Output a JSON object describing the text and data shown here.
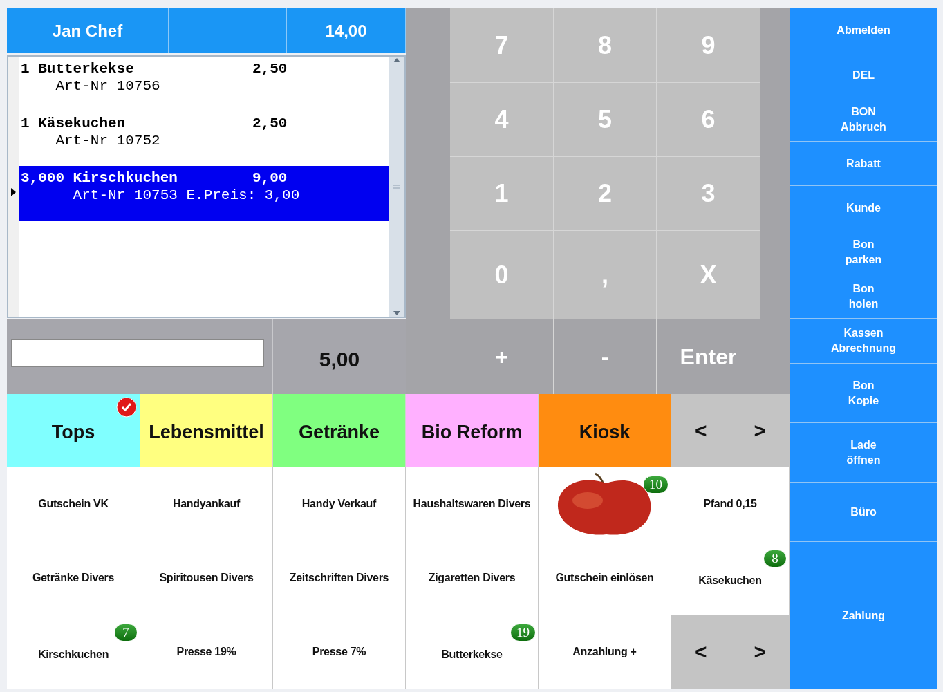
{
  "header": {
    "user": "Jan Chef",
    "total": "14,00"
  },
  "receipt": {
    "lines": [
      {
        "qty": "1",
        "name": "Butterkekse",
        "price": "2,50",
        "detail": "Art-Nr 10756",
        "selected": false
      },
      {
        "qty": "1",
        "name": "Käsekuchen",
        "price": "2,50",
        "detail": "Art-Nr 10752",
        "selected": false
      },
      {
        "qty": "3,000",
        "name": "Kirschkuchen",
        "price": "9,00",
        "detail": "Art-Nr 10753 E.Preis: 3,00",
        "selected": true
      }
    ]
  },
  "entry": {
    "amount": "5,00"
  },
  "keypad": [
    [
      "7",
      "8",
      "9"
    ],
    [
      "4",
      "5",
      "6"
    ],
    [
      "1",
      "2",
      "3"
    ],
    [
      "0",
      ",",
      "X"
    ],
    [
      "+",
      "-",
      "Enter"
    ]
  ],
  "categories": [
    {
      "label": "Tops",
      "color": "#80ffff",
      "selected": true
    },
    {
      "label": "Lebensmittel",
      "color": "#ffff80",
      "selected": false
    },
    {
      "label": "Getränke",
      "color": "#80ff80",
      "selected": false
    },
    {
      "label": "Bio Reform",
      "color": "#ffb0ff",
      "selected": false
    },
    {
      "label": "Kiosk",
      "color": "#ff8c10",
      "selected": false
    }
  ],
  "category_nav": {
    "prev": "<",
    "next": ">"
  },
  "products": [
    {
      "kind": "text",
      "label": "Gutschein VK"
    },
    {
      "kind": "text",
      "label": "Handyankauf"
    },
    {
      "kind": "text",
      "label": "Handy Verkauf"
    },
    {
      "kind": "text",
      "label": "Haushaltswaren Divers"
    },
    {
      "kind": "image",
      "badge": "10"
    },
    {
      "kind": "text",
      "label": "Pfand 0,15"
    },
    {
      "kind": "text",
      "label": "Getränke Divers"
    },
    {
      "kind": "text",
      "label": "Spiritousen Divers"
    },
    {
      "kind": "text",
      "label": "Zeitschriften Divers"
    },
    {
      "kind": "text",
      "label": "Zigaretten Divers"
    },
    {
      "kind": "text",
      "label": "Gutschein einlösen"
    },
    {
      "kind": "text",
      "label": "Käsekuchen",
      "badge": "8"
    },
    {
      "kind": "text",
      "label": "Kirschkuchen",
      "badge": "7"
    },
    {
      "kind": "text",
      "label": "Presse 19%"
    },
    {
      "kind": "text",
      "label": "Presse 7%"
    },
    {
      "kind": "text",
      "label": "Butterkekse",
      "badge": "19"
    },
    {
      "kind": "text",
      "label": "Anzahlung +"
    }
  ],
  "product_nav": {
    "prev": "<",
    "next": ">"
  },
  "functions": [
    "Abmelden",
    "DEL",
    "BON\nAbbruch",
    "Rabatt",
    "Kunde",
    "Bon\nparken",
    "Bon\nholen",
    "Kassen\nAbrechnung",
    "Bon\nKopie",
    "Lade\nöffnen",
    "Büro",
    "Zahlung"
  ]
}
